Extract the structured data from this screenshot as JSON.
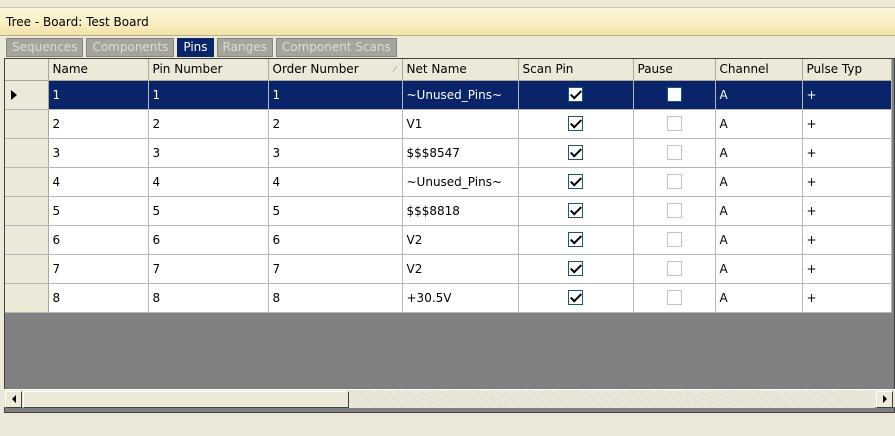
{
  "window": {
    "title": "Tree - Board: Test Board"
  },
  "tabs": [
    {
      "label": "Sequences",
      "active": false
    },
    {
      "label": "Components",
      "active": false
    },
    {
      "label": "Pins",
      "active": true
    },
    {
      "label": "Ranges",
      "active": false
    },
    {
      "label": "Component Scans",
      "active": false
    }
  ],
  "grid": {
    "columns": [
      "Name",
      "Pin Number",
      "Order Number",
      "Net Name",
      "Scan Pin",
      "Pause",
      "Channel",
      "Pulse Typ"
    ],
    "sort_column": "Order Number",
    "rows": [
      {
        "name": "1",
        "pin_number": "1",
        "order_number": "1",
        "net_name": "~Unused_Pins~",
        "scan_pin": true,
        "pause": false,
        "channel": "A",
        "pulse_type": "+",
        "selected": true
      },
      {
        "name": "2",
        "pin_number": "2",
        "order_number": "2",
        "net_name": "V1",
        "scan_pin": true,
        "pause": false,
        "channel": "A",
        "pulse_type": "+",
        "selected": false
      },
      {
        "name": "3",
        "pin_number": "3",
        "order_number": "3",
        "net_name": "$$$8547",
        "scan_pin": true,
        "pause": false,
        "channel": "A",
        "pulse_type": "+",
        "selected": false
      },
      {
        "name": "4",
        "pin_number": "4",
        "order_number": "4",
        "net_name": "~Unused_Pins~",
        "scan_pin": true,
        "pause": false,
        "channel": "A",
        "pulse_type": "+",
        "selected": false
      },
      {
        "name": "5",
        "pin_number": "5",
        "order_number": "5",
        "net_name": "$$$8818",
        "scan_pin": true,
        "pause": false,
        "channel": "A",
        "pulse_type": "+",
        "selected": false
      },
      {
        "name": "6",
        "pin_number": "6",
        "order_number": "6",
        "net_name": "V2",
        "scan_pin": true,
        "pause": false,
        "channel": "A",
        "pulse_type": "+",
        "selected": false
      },
      {
        "name": "7",
        "pin_number": "7",
        "order_number": "7",
        "net_name": "V2",
        "scan_pin": true,
        "pause": false,
        "channel": "A",
        "pulse_type": "+",
        "selected": false
      },
      {
        "name": "8",
        "pin_number": "8",
        "order_number": "8",
        "net_name": "+30.5V",
        "scan_pin": true,
        "pause": false,
        "channel": "A",
        "pulse_type": "+",
        "selected": false
      }
    ]
  },
  "icons": {
    "row_pointer": "triangle-right-icon",
    "scroll_left": "arrow-left-icon",
    "scroll_right": "arrow-right-icon"
  },
  "colors": {
    "selection": "#0a246a",
    "title_bar": "#f9efc4",
    "inactive_tab": "#a5a49d"
  }
}
